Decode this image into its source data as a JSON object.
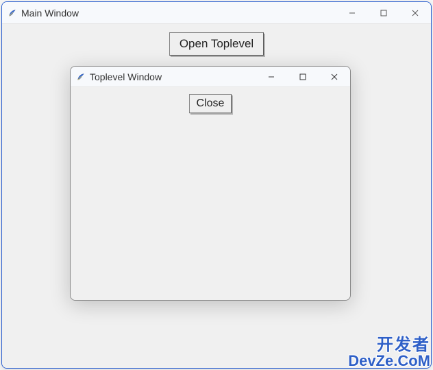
{
  "main_window": {
    "title": "Main Window",
    "open_button_label": "Open Toplevel"
  },
  "toplevel_window": {
    "title": "Toplevel Window",
    "close_button_label": "Close"
  },
  "watermark": {
    "line1": "开发者",
    "line2": "DevZe.CoM"
  }
}
